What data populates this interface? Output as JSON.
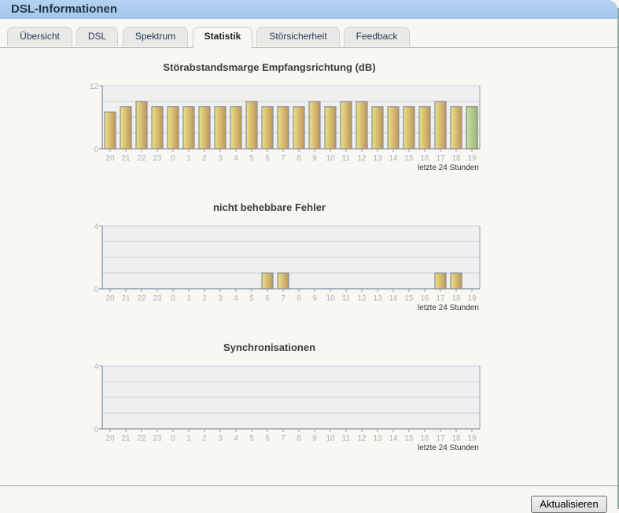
{
  "window": {
    "title": "DSL-Informationen"
  },
  "tabs": [
    {
      "label": "Übersicht",
      "active": false
    },
    {
      "label": "DSL",
      "active": false
    },
    {
      "label": "Spektrum",
      "active": false
    },
    {
      "label": "Statistik",
      "active": true
    },
    {
      "label": "Störsicherheit",
      "active": false
    },
    {
      "label": "Feedback",
      "active": false
    }
  ],
  "colors": {
    "bar_normal_light": "#ece382",
    "bar_normal_dark": "#bf955e",
    "bar_current_light": "#cde0a2",
    "bar_current_dark": "#9ab27a",
    "plot_bg": "#efefef",
    "grid": "#c6d2de",
    "axis": "#92a0b0",
    "tick_label": "#a8b4c2"
  },
  "chart_data": [
    {
      "type": "bar",
      "title": "Störabstandsmarge Empfangsrichtung (dB)",
      "xlabel": "letzte 24 Stunden",
      "ylabel": "",
      "ylim": [
        0,
        12
      ],
      "yticks": [
        "0",
        "12"
      ],
      "grid": true,
      "categories": [
        "20",
        "21",
        "22",
        "23",
        "0",
        "1",
        "2",
        "3",
        "4",
        "5",
        "6",
        "7",
        "8",
        "9",
        "10",
        "11",
        "12",
        "13",
        "14",
        "15",
        "16",
        "17",
        "18",
        "19"
      ],
      "values": [
        7,
        8,
        9,
        8,
        8,
        8,
        8,
        8,
        8,
        9,
        8,
        8,
        8,
        9,
        8,
        9,
        9,
        8,
        8,
        8,
        8,
        9,
        8,
        8
      ],
      "current_index": 23
    },
    {
      "type": "bar",
      "title": "nicht behebbare Fehler",
      "xlabel": "letzte 24 Stunden",
      "ylabel": "",
      "ylim": [
        0,
        4
      ],
      "yticks": [
        "0",
        "4"
      ],
      "grid": true,
      "categories": [
        "20",
        "21",
        "22",
        "23",
        "0",
        "1",
        "2",
        "3",
        "4",
        "5",
        "6",
        "7",
        "8",
        "9",
        "10",
        "11",
        "12",
        "13",
        "14",
        "15",
        "16",
        "17",
        "18",
        "19"
      ],
      "values": [
        0,
        0,
        0,
        0,
        0,
        0,
        0,
        0,
        0,
        0,
        1,
        1,
        0,
        0,
        0,
        0,
        0,
        0,
        0,
        0,
        0,
        1,
        1,
        0
      ],
      "current_index": 23
    },
    {
      "type": "bar",
      "title": "Synchronisationen",
      "xlabel": "letzte 24 Stunden",
      "ylabel": "",
      "ylim": [
        0,
        4
      ],
      "yticks": [
        "0",
        "4"
      ],
      "grid": true,
      "categories": [
        "20",
        "21",
        "22",
        "23",
        "0",
        "1",
        "2",
        "3",
        "4",
        "5",
        "6",
        "7",
        "8",
        "9",
        "10",
        "11",
        "12",
        "13",
        "14",
        "15",
        "16",
        "17",
        "18",
        "19"
      ],
      "values": [
        0,
        0,
        0,
        0,
        0,
        0,
        0,
        0,
        0,
        0,
        0,
        0,
        0,
        0,
        0,
        0,
        0,
        0,
        0,
        0,
        0,
        0,
        0,
        0
      ],
      "current_index": 23
    }
  ],
  "footer": {
    "refresh_label": "Aktualisieren"
  }
}
